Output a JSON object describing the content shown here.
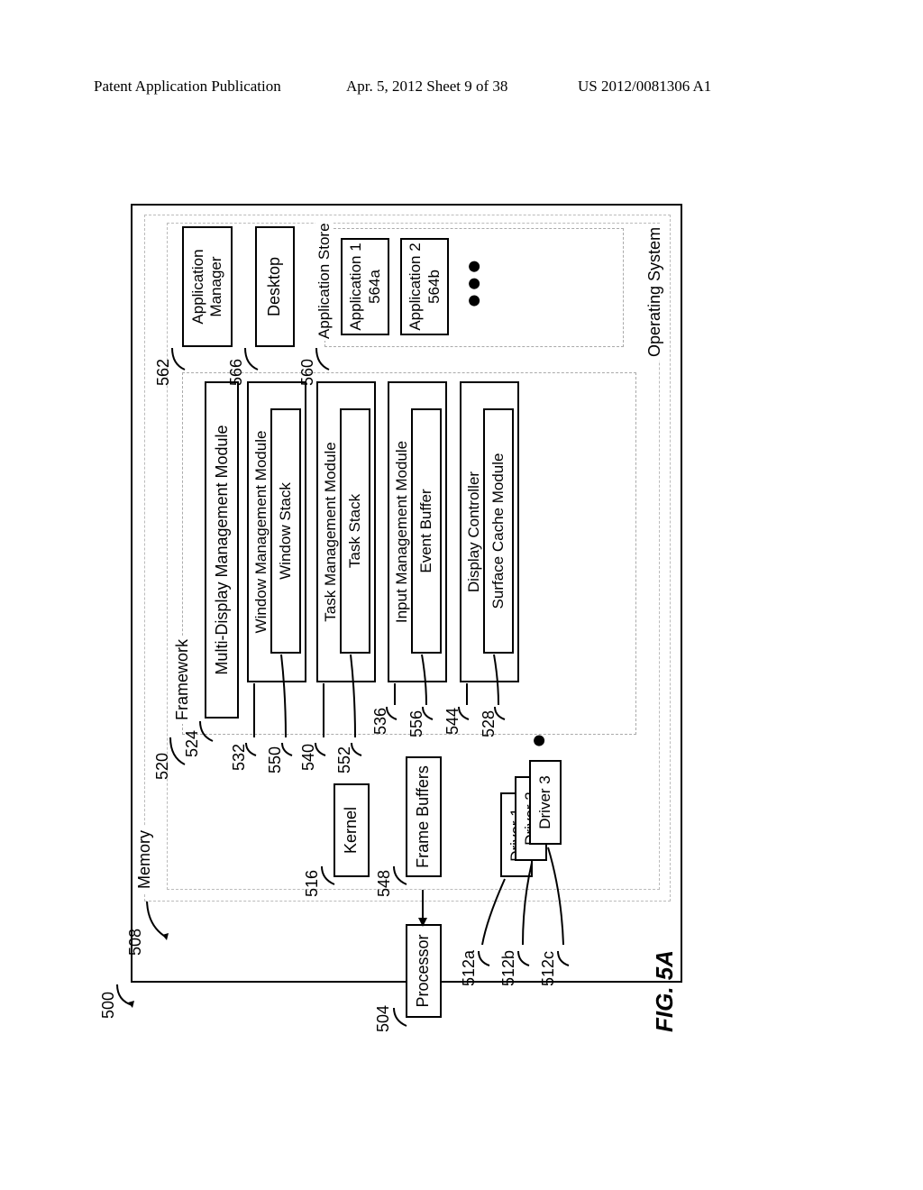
{
  "header": {
    "left": "Patent Application Publication",
    "center": "Apr. 5, 2012   Sheet 9 of 38",
    "right": "US 2012/0081306 A1"
  },
  "figure": "FIG. 5A",
  "refs": {
    "r500": "500",
    "r508": "508",
    "r504": "504",
    "r512a": "512a",
    "r512b": "512b",
    "r512c": "512c",
    "r516": "516",
    "r548": "548",
    "r520": "520",
    "r524": "524",
    "r532": "532",
    "r550": "550",
    "r540": "540",
    "r552": "552",
    "r536": "536",
    "r556": "556",
    "r544": "544",
    "r528": "528",
    "r562": "562",
    "r566": "566",
    "r560": "560"
  },
  "labels": {
    "processor": "Processor",
    "memory": "Memory",
    "os": "Operating System",
    "kernel": "Kernel",
    "framebuffers": "Frame Buffers",
    "driver1": "Driver 1",
    "driver2": "Driver 2",
    "driver3": "Driver 3",
    "framework": "Framework",
    "mdmm": "Multi-Display Management Module",
    "wmm": "Window Management Module",
    "wstack": "Window Stack",
    "tmm": "Task Management Module",
    "tstack": "Task Stack",
    "imm": "Input Management Module",
    "ebuf": "Event Buffer",
    "dispctrl": "Display Controller",
    "scache": "Surface Cache Module",
    "appstore": "Application Store",
    "appmgr": "Application\nManager",
    "desktop": "Desktop",
    "app1": "Application 1",
    "app1n": "564a",
    "app2": "Application 2",
    "app2n": "564b"
  }
}
